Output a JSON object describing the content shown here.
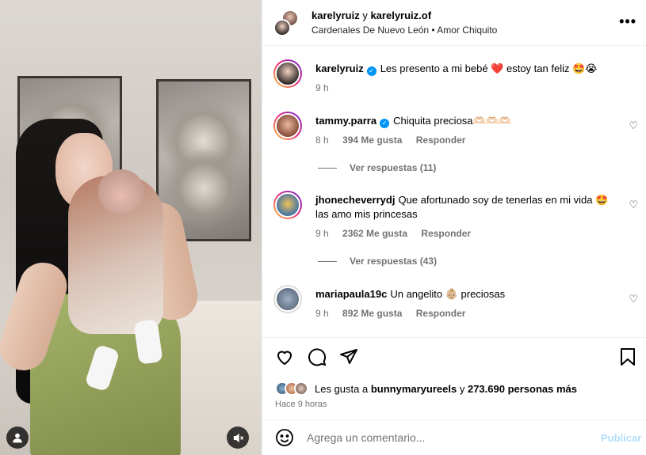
{
  "header": {
    "user1": "karelyruiz",
    "joiner": "y",
    "user2": "karelyruiz.of",
    "subtitle": "Cardenales De Nuevo León • Amor Chiquito",
    "more_icon": "more-dots-icon"
  },
  "caption": {
    "username": "karelyruiz",
    "text": "Les presento a mi bebé ❤️ estoy tan feliz 🤩😭",
    "time": "9 h"
  },
  "comments": [
    {
      "username": "tammy.parra",
      "verified": true,
      "text": "Chiquita preciosa🫶🏻🫶🏻🫶🏻",
      "time": "8 h",
      "likes": "394 Me gusta",
      "reply": "Responder",
      "view_replies": "Ver respuestas (11)"
    },
    {
      "username": "jhonecheverrydj",
      "verified": false,
      "text": "Que afortunado soy de tenerlas en mi vida 🤩 las amo mis princesas",
      "time": "9 h",
      "likes": "2362 Me gusta",
      "reply": "Responder",
      "view_replies": "Ver respuestas (43)"
    },
    {
      "username": "mariapaula19c",
      "verified": false,
      "text": "Un angelito 👶🏼 preciosas",
      "time": "9 h",
      "likes": "892 Me gusta",
      "reply": "Responder"
    }
  ],
  "likes_summary": {
    "prefix": "Les gusta a",
    "user": "bunnymaryureels",
    "middle": "y",
    "count": "273.690 personas más"
  },
  "posted": "Hace 9 horas",
  "add_comment": {
    "placeholder": "Agrega un comentario...",
    "publish": "Publicar"
  },
  "colors": {
    "accent": "#0095f6",
    "publish_disabled": "#b2dffc",
    "secondary_text": "#737373"
  }
}
